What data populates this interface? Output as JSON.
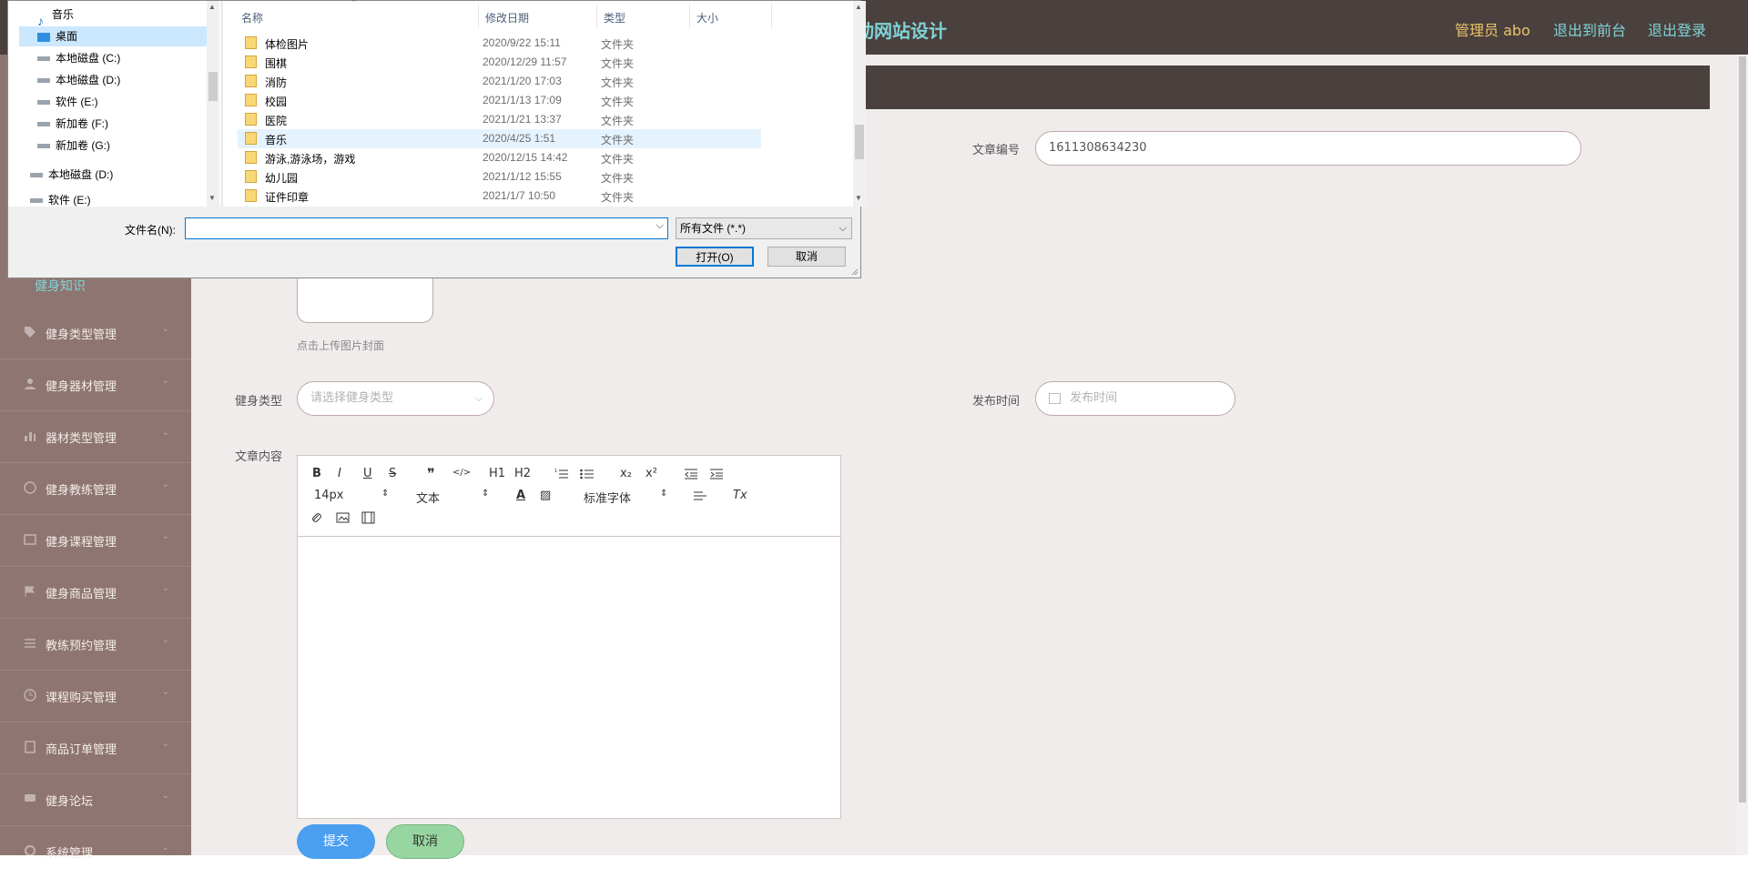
{
  "topbar": {
    "title": "动网站设计",
    "admin": "管理员 abo",
    "to_front": "退出到前台",
    "logout": "退出登录"
  },
  "sidebar": {
    "sub_active": "健身知识",
    "items": [
      {
        "label": "健身类型管理",
        "icon": "tag-icon"
      },
      {
        "label": "健身器材管理",
        "icon": "user-icon"
      },
      {
        "label": "器材类型管理",
        "icon": "bar-chart-icon"
      },
      {
        "label": "健身教练管理",
        "icon": "clock-icon"
      },
      {
        "label": "健身课程管理",
        "icon": "list-icon"
      },
      {
        "label": "健身商品管理",
        "icon": "flag-icon"
      },
      {
        "label": "教练预约管理",
        "icon": "menu-icon"
      },
      {
        "label": "课程购买管理",
        "icon": "clock-icon"
      },
      {
        "label": "商品订单管理",
        "icon": "document-icon"
      },
      {
        "label": "健身论坛",
        "icon": "chat-icon"
      },
      {
        "label": "系统管理",
        "icon": "gear-icon"
      }
    ]
  },
  "form": {
    "article_no_label": "文章编号",
    "article_no_value": "1611308634230",
    "upload_hint": "点击上传图片封面",
    "type_label": "健身类型",
    "type_placeholder": "请选择健身类型",
    "publish_label": "发布时间",
    "publish_placeholder": "发布时间",
    "content_label": "文章内容",
    "submit": "提交",
    "cancel": "取消"
  },
  "editor": {
    "font_size": "14px",
    "heading_select": "文本",
    "font_family": "标准字体",
    "btn_bold": "B",
    "btn_italic": "I",
    "btn_underline": "U",
    "btn_strike": "S",
    "btn_quote": "❞",
    "btn_code": "</>",
    "btn_h1": "H1",
    "btn_h2": "H2",
    "btn_sub": "x₂",
    "btn_sup": "x²",
    "btn_clear": "Tx"
  },
  "dialog": {
    "nav": [
      {
        "label": "音乐",
        "icon": "music-icon"
      },
      {
        "label": "桌面",
        "icon": "desktop-icon"
      },
      {
        "label": "本地磁盘 (C:)",
        "icon": "drive-icon"
      },
      {
        "label": "本地磁盘 (D:)",
        "icon": "drive-icon"
      },
      {
        "label": "软件 (E:)",
        "icon": "drive-icon"
      },
      {
        "label": "新加卷 (F:)",
        "icon": "drive-icon"
      },
      {
        "label": "新加卷 (G:)",
        "icon": "drive-icon"
      },
      {
        "label": "本地磁盘 (D:)",
        "icon": "drive-icon"
      },
      {
        "label": "软件 (E:)",
        "icon": "drive-icon"
      }
    ],
    "columns": {
      "name": "名称",
      "date": "修改日期",
      "type": "类型",
      "size": "大小"
    },
    "files": [
      {
        "name": "体检图片",
        "date": "2020/9/22 15:11",
        "type": "文件夹"
      },
      {
        "name": "围棋",
        "date": "2020/12/29 11:57",
        "type": "文件夹"
      },
      {
        "name": "消防",
        "date": "2021/1/20 17:03",
        "type": "文件夹"
      },
      {
        "name": "校园",
        "date": "2021/1/13 17:09",
        "type": "文件夹"
      },
      {
        "name": "医院",
        "date": "2021/1/21 13:37",
        "type": "文件夹"
      },
      {
        "name": "音乐",
        "date": "2020/4/25 1:51",
        "type": "文件夹"
      },
      {
        "name": "游泳,游泳场，游戏",
        "date": "2020/12/15 14:42",
        "type": "文件夹"
      },
      {
        "name": "幼儿园",
        "date": "2021/1/12 15:55",
        "type": "文件夹"
      },
      {
        "name": "证件印章",
        "date": "2021/1/7 10:50",
        "type": "文件夹"
      }
    ],
    "filename_label": "文件名(N):",
    "filename_value": "",
    "filetype_value": "所有文件 (*.*)",
    "open_button": "打开(O)",
    "cancel_button": "取消"
  }
}
